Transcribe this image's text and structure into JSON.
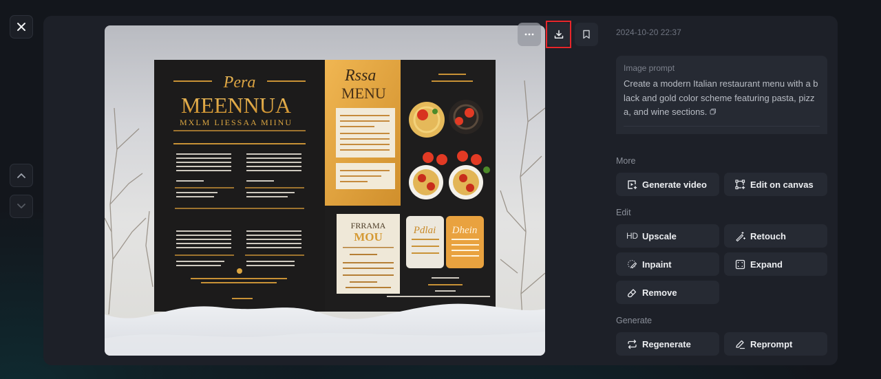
{
  "nav": {
    "close_icon": "close-icon",
    "prev_icon": "chevron-up-icon",
    "next_icon": "chevron-down-icon"
  },
  "image": {
    "alt": "Italian restaurant menu in black and gold",
    "headline_script": "Pera",
    "headline": "MEENNUA",
    "subline": "MXLM LIESSAA MIINU",
    "right_script": "Rssa",
    "right_title": "MENU",
    "card_title": "FRRAMA",
    "card_subtitle": "MOU",
    "small_card_1": "Pdlai",
    "small_card_2": "Dhein",
    "colors": {
      "gold": "#d9a441",
      "black": "#1b1a1a",
      "cream": "#efe8d8"
    }
  },
  "toolbar": {
    "more_icon": "more-horizontal-icon",
    "download_icon": "download-icon",
    "bookmark_icon": "bookmark-icon",
    "highlight_color": "#e8262a"
  },
  "details": {
    "timestamp": "2024-10-20 22:37",
    "prompt_label": "Image prompt",
    "prompt_text": "Create a modern Italian restaurant menu with a black and gold color scheme featuring pasta, pizza, and wine sections."
  },
  "sections": {
    "more": {
      "label": "More",
      "buttons": [
        {
          "label": "Generate video",
          "icon": "video-plus-icon"
        },
        {
          "label": "Edit on canvas",
          "icon": "canvas-edit-icon"
        }
      ]
    },
    "edit": {
      "label": "Edit",
      "buttons": [
        {
          "label": "Upscale",
          "icon": "HD"
        },
        {
          "label": "Retouch",
          "icon": "magic-wand-icon"
        },
        {
          "label": "Inpaint",
          "icon": "inpaint-brush-icon"
        },
        {
          "label": "Expand",
          "icon": "expand-icon"
        },
        {
          "label": "Remove",
          "icon": "eraser-icon"
        }
      ]
    },
    "generate": {
      "label": "Generate",
      "buttons": [
        {
          "label": "Regenerate",
          "icon": "repeat-icon"
        },
        {
          "label": "Reprompt",
          "icon": "pencil-icon"
        }
      ]
    }
  }
}
